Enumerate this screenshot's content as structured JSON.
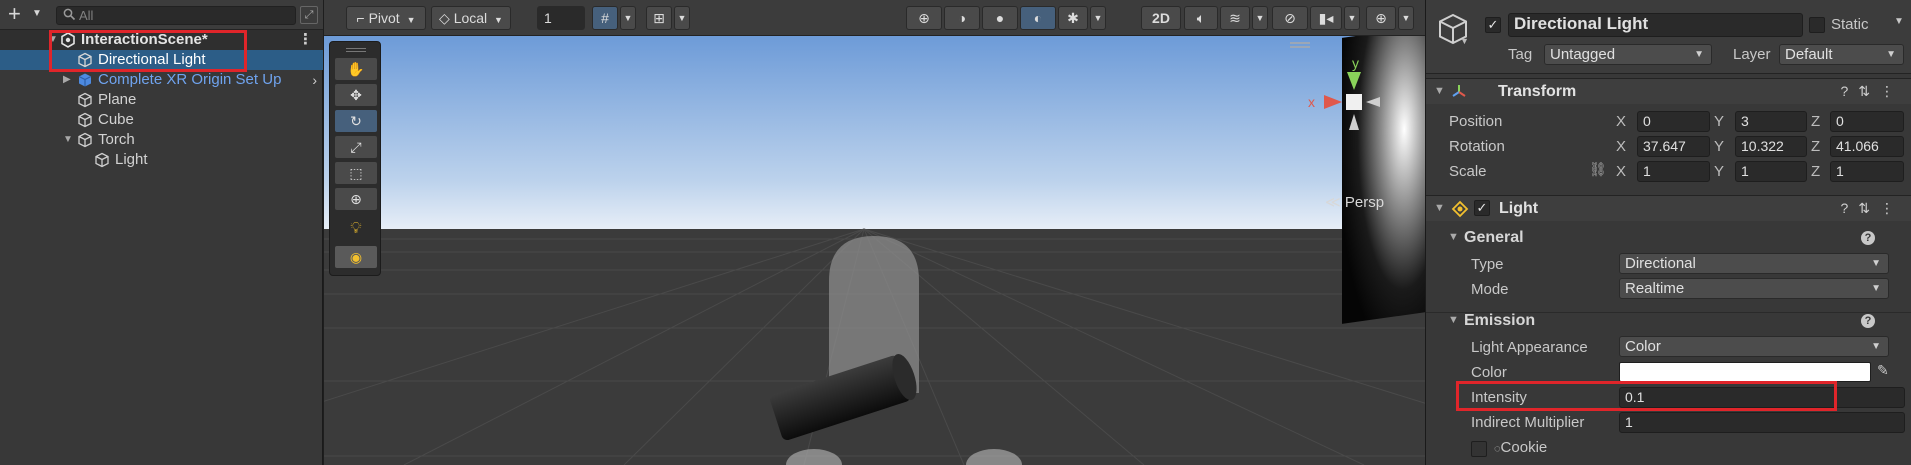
{
  "hierarchy": {
    "add_label": "+",
    "search_placeholder": "All",
    "scene_name": "InteractionScene*",
    "items": [
      {
        "label": "Directional Light"
      },
      {
        "label": "Complete XR Origin Set Up"
      },
      {
        "label": "Plane"
      },
      {
        "label": "Cube"
      },
      {
        "label": "Torch"
      },
      {
        "label": "Light"
      }
    ]
  },
  "scene_toolbar": {
    "pivot_label": "Pivot",
    "local_label": "Local",
    "snap_value": "1",
    "mode_2d_label": "2D"
  },
  "scene_view": {
    "gizmo_x": "x",
    "gizmo_y": "y",
    "persp_label": "Persp"
  },
  "inspector": {
    "object_name": "Directional Light",
    "static_label": "Static",
    "tag_label": "Tag",
    "tag_value": "Untagged",
    "layer_label": "Layer",
    "layer_value": "Default",
    "transform": {
      "title": "Transform",
      "position_label": "Position",
      "rotation_label": "Rotation",
      "scale_label": "Scale",
      "position": {
        "x": "0",
        "y": "3",
        "z": "0"
      },
      "rotation": {
        "x": "37.647",
        "y": "10.322",
        "z": "41.066"
      },
      "scale": {
        "x": "1",
        "y": "1",
        "z": "1"
      },
      "axis_x": "X",
      "axis_y": "Y",
      "axis_z": "Z"
    },
    "light": {
      "title": "Light",
      "general_title": "General",
      "type_label": "Type",
      "type_value": "Directional",
      "mode_label": "Mode",
      "mode_value": "Realtime",
      "emission_title": "Emission",
      "appearance_label": "Light Appearance",
      "appearance_value": "Color",
      "color_label": "Color",
      "color_value": "#ffffff",
      "intensity_label": "Intensity",
      "intensity_value": "0.1",
      "indirect_label": "Indirect Multiplier",
      "indirect_value": "1",
      "cookie_label": "Cookie"
    }
  },
  "colors": {
    "selection": "#2c5d87",
    "highlight_box": "#e0252a",
    "prefab_text": "#6fa3ee"
  }
}
